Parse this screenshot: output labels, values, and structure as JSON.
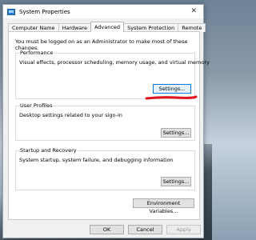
{
  "window": {
    "title": "System Properties",
    "close_glyph": "✕",
    "icon": "system-properties-icon"
  },
  "tabs": [
    {
      "label": "Computer Name",
      "active": false
    },
    {
      "label": "Hardware",
      "active": false
    },
    {
      "label": "Advanced",
      "active": true
    },
    {
      "label": "System Protection",
      "active": false
    },
    {
      "label": "Remote",
      "active": false
    }
  ],
  "advanced": {
    "admin_note": "You must be logged on as an Administrator to make most of these changes.",
    "performance": {
      "title": "Performance",
      "description": "Visual effects, processor scheduling, memory usage, and virtual memory",
      "button": "Settings..."
    },
    "user_profiles": {
      "title": "User Profiles",
      "description": "Desktop settings related to your sign-in",
      "button": "Settings..."
    },
    "startup_recovery": {
      "title": "Startup and Recovery",
      "description": "System startup, system failure, and debugging information",
      "button": "Settings..."
    },
    "env_button": "Environment Variables..."
  },
  "footer": {
    "ok": "OK",
    "cancel": "Cancel",
    "apply": "Apply"
  },
  "colors": {
    "annotation": "#e0141e",
    "focus_border": "#0a78d7"
  }
}
